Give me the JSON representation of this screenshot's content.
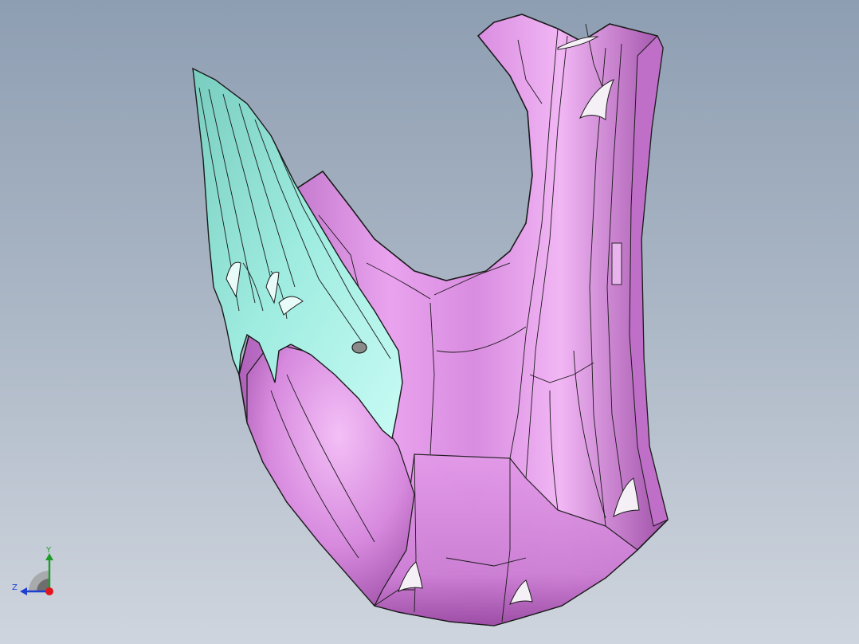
{
  "viewport": {
    "background_top": "#8e9eb2",
    "background_bottom": "#cfd5de"
  },
  "model": {
    "body_color": "#d98ce0",
    "body_highlight": "#f1b6f4",
    "body_shadow": "#9f4fa8",
    "fin_color": "#8fe6d9",
    "fin_highlight": "#c8fbf4",
    "edge_color": "#1a1a1a"
  },
  "triad": {
    "y_label": "Y",
    "z_label": "Z",
    "y_color": "#1f9d2a",
    "z_color": "#1e3fd1",
    "x_color": "#e0141c"
  }
}
